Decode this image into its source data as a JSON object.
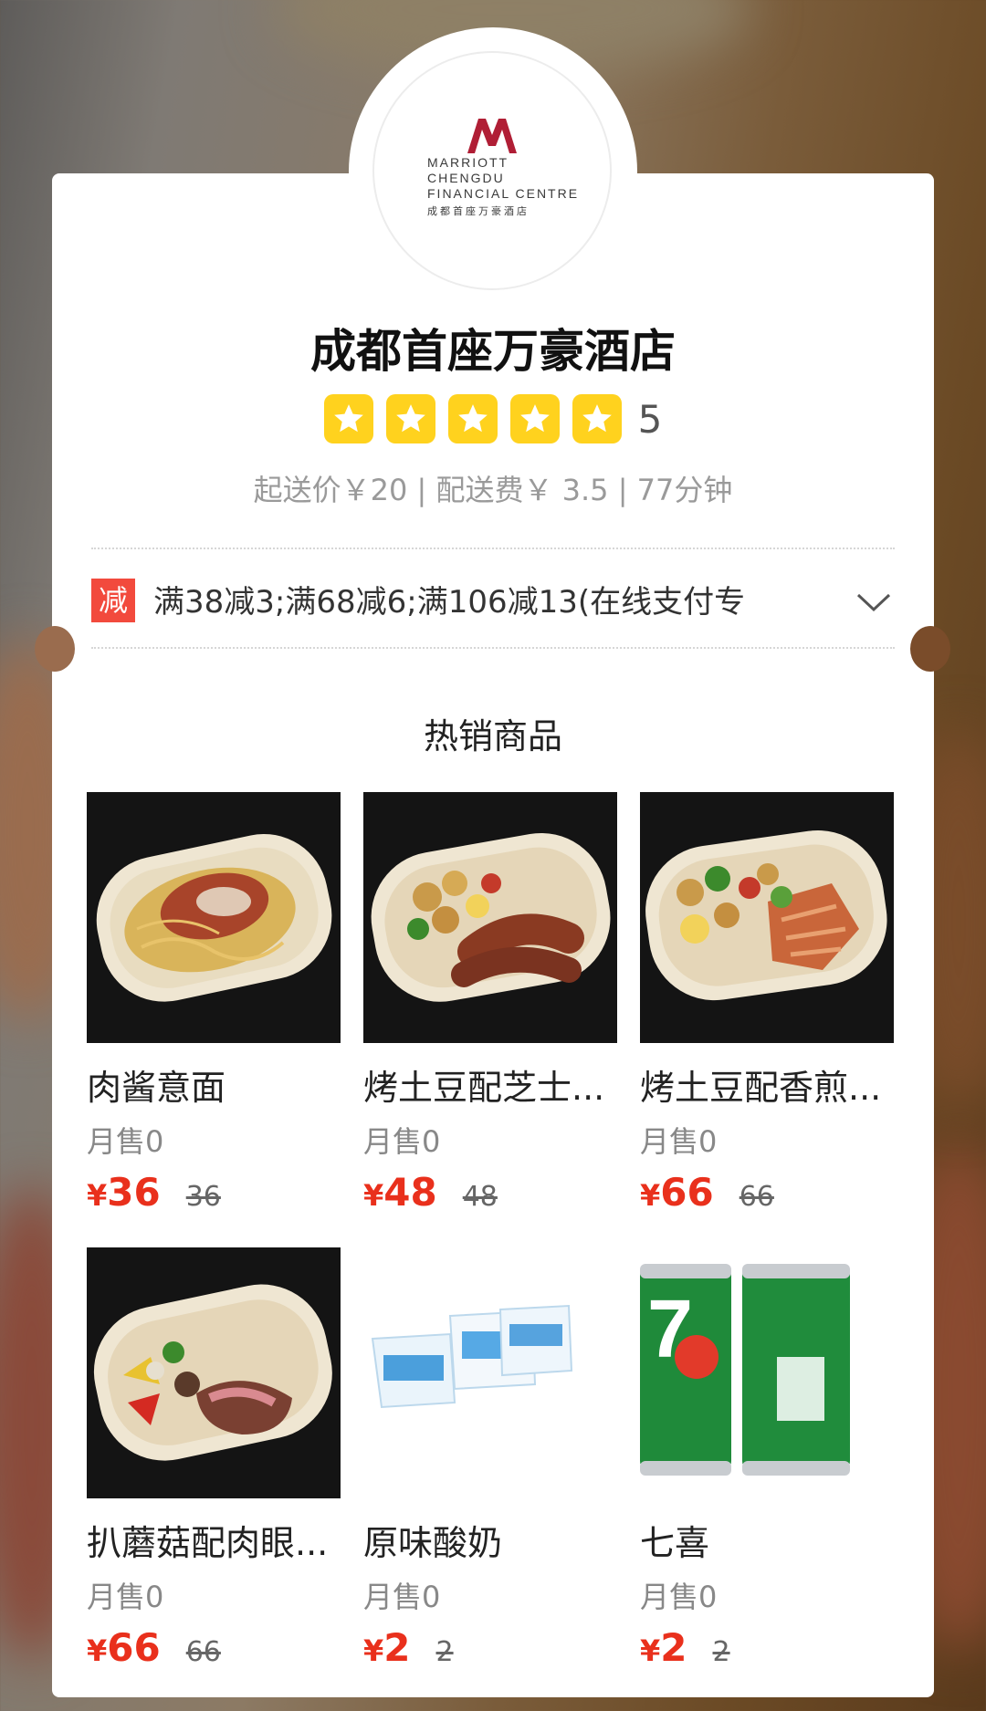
{
  "store": {
    "brand_lines": [
      "MARRIOTT",
      "CHENGDU",
      "FINANCIAL CENTRE"
    ],
    "brand_cn": "成都首座万豪酒店",
    "name": "成都首座万豪酒店",
    "rating": "5",
    "rating_stars": 5,
    "delivery_info": "起送价￥20 | 配送费￥ 3.5 | 77分钟"
  },
  "promo": {
    "tag": "减",
    "text": "满38减3;满68减6;满106减13(在线支付专"
  },
  "section": {
    "title": "热销商品"
  },
  "currency": "¥",
  "products": [
    {
      "name": "肉酱意面",
      "sales": "月售0",
      "price": "36",
      "original": "36",
      "image": "pasta-bowl"
    },
    {
      "name": "烤土豆配芝士...",
      "sales": "月售0",
      "price": "48",
      "original": "48",
      "image": "potato-sausage-bowl"
    },
    {
      "name": "烤土豆配香煎...",
      "sales": "月售0",
      "price": "66",
      "original": "66",
      "image": "potato-salmon-bowl"
    },
    {
      "name": "扒蘑菇配肉眼...",
      "sales": "月售0",
      "price": "66",
      "original": "66",
      "image": "steak-mushroom-bowl"
    },
    {
      "name": "原味酸奶",
      "sales": "月售0",
      "price": "2",
      "original": "2",
      "image": "yogurt-cups"
    },
    {
      "name": "七喜",
      "sales": "月售0",
      "price": "2",
      "original": "2",
      "image": "7up-cans"
    }
  ],
  "colors": {
    "accent_red": "#e9301c",
    "star_yellow": "#ffd21e",
    "promo_tag": "#f24a3d",
    "brand_red": "#b01e35"
  }
}
